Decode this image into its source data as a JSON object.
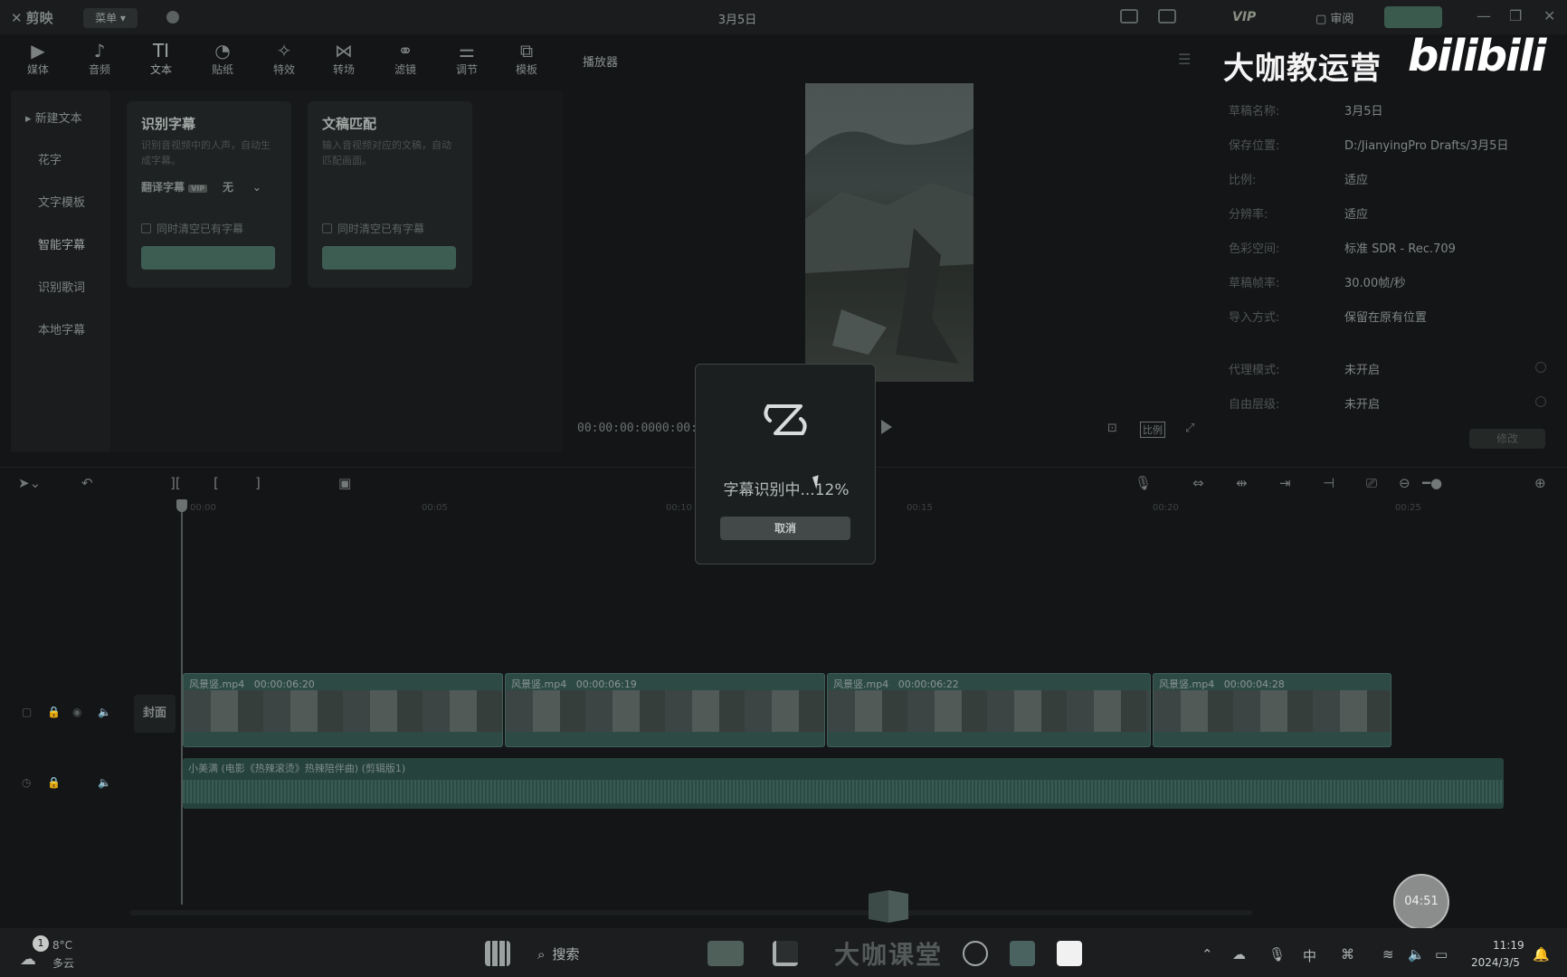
{
  "app": {
    "name": "剪映",
    "menu_label": "菜单",
    "draft_title": "3月5日",
    "vip_label": "VIP",
    "review_label": "审阅"
  },
  "toolbar": {
    "tabs": [
      {
        "label": "媒体",
        "icon": "media-icon"
      },
      {
        "label": "音频",
        "icon": "audio-icon"
      },
      {
        "label": "文本",
        "icon": "text-icon"
      },
      {
        "label": "贴纸",
        "icon": "sticker-icon"
      },
      {
        "label": "特效",
        "icon": "effects-icon"
      },
      {
        "label": "转场",
        "icon": "transition-icon"
      },
      {
        "label": "滤镜",
        "icon": "filter-icon"
      },
      {
        "label": "调节",
        "icon": "adjust-icon"
      },
      {
        "label": "模板",
        "icon": "template-icon"
      }
    ]
  },
  "leftnav": {
    "items": [
      "新建文本",
      "花字",
      "文字模板",
      "智能字幕",
      "识别歌词",
      "本地字幕"
    ]
  },
  "panel": {
    "card1": {
      "title": "识别字幕",
      "desc": "识别音视频中的人声，自动生成字幕。",
      "translate_label": "翻译字幕",
      "translate_value": "无",
      "clear_label": "同时清空已有字幕"
    },
    "card2": {
      "title": "文稿匹配",
      "desc": "输入音视频对应的文稿，自动匹配画面。",
      "clear_label": "同时清空已有字幕"
    }
  },
  "player": {
    "title": "播放器",
    "current_time": "00:00:00:00",
    "total_time": "00:00:2",
    "ratio_label": "比例"
  },
  "draft_props": [
    {
      "label": "草稿名称:",
      "value": "3月5日"
    },
    {
      "label": "保存位置:",
      "value": "D:/JianyingPro Drafts/3月5日"
    },
    {
      "label": "比例:",
      "value": "适应"
    },
    {
      "label": "分辨率:",
      "value": "适应"
    },
    {
      "label": "色彩空间:",
      "value": "标准 SDR - Rec.709"
    },
    {
      "label": "草稿帧率:",
      "value": "30.00帧/秒"
    },
    {
      "label": "导入方式:",
      "value": "保留在原有位置"
    },
    {
      "label": "代理模式:",
      "value": "未开启"
    },
    {
      "label": "自由层级:",
      "value": "未开启"
    }
  ],
  "modify_label": "修改",
  "overlay": {
    "brand_text": "大咖教运营",
    "site_logo": "bilibili"
  },
  "timeline": {
    "ruler": [
      "00:00",
      "00:05",
      "00:10",
      "00:15",
      "00:20",
      "00:25"
    ],
    "cover_label": "封面",
    "clips": [
      {
        "name": "风景竖.mp4",
        "duration": "00:00:06:20"
      },
      {
        "name": "风景竖.mp4",
        "duration": "00:00:06:19"
      },
      {
        "name": "风景竖.mp4",
        "duration": "00:00:06:22"
      },
      {
        "name": "风景竖.mp4",
        "duration": "00:00:04:28"
      }
    ],
    "audio_label": "小美满 (电影《热辣滚烫》热辣陪伴曲) (剪辑版1)"
  },
  "modal": {
    "status": "字幕识别中...12%",
    "progress_percent": 12,
    "cancel_label": "取消"
  },
  "floating_avatar_text": "04:51",
  "taskbar": {
    "weather_badge": "1",
    "temperature": "8°C",
    "condition": "多云",
    "search_label": "搜索",
    "watermark": "大咖课堂",
    "time": "11:19",
    "date": "2024/3/5"
  }
}
